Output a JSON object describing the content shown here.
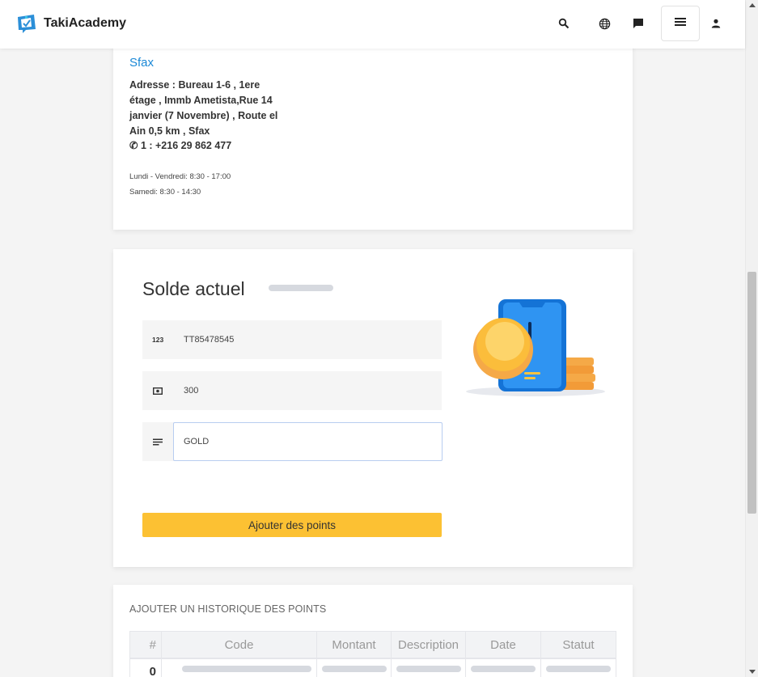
{
  "header": {
    "brand": "TakiAcademy",
    "icons": [
      "search-icon",
      "globe-icon",
      "chat-icon",
      "menu-icon",
      "person-icon"
    ]
  },
  "location": {
    "city": "Sfax",
    "address": "Adresse : Bureau 1-6 , 1ere étage , Immb Ametista,Rue 14 janvier (7 Novembre) , Route el Ain 0,5 km , Sfax",
    "phone": "✆ 1 : +216 29 862 477",
    "hours_weekdays": "Lundi - Vendredi: 8:30 - 17:00",
    "hours_saturday": "Samedi: 8:30 - 14:30"
  },
  "solde": {
    "title": "Solde actuel",
    "fields": [
      {
        "icon": "numbers-icon",
        "value": "TT85478545"
      },
      {
        "icon": "money-icon",
        "value": "300"
      },
      {
        "icon": "notes-icon",
        "value": "GOLD"
      }
    ],
    "add_button": "Ajouter des points"
  },
  "history": {
    "title": "AJOUTER UN HISTORIQUE DES POINTS",
    "columns": [
      "#",
      "Code",
      "Montant",
      "Description",
      "Date",
      "Statut"
    ],
    "rows": [
      {
        "index": "0"
      }
    ]
  },
  "colors": {
    "accent": "#fcc133",
    "link": "#1a88d6",
    "brand_blue": "#2b8fd8"
  }
}
